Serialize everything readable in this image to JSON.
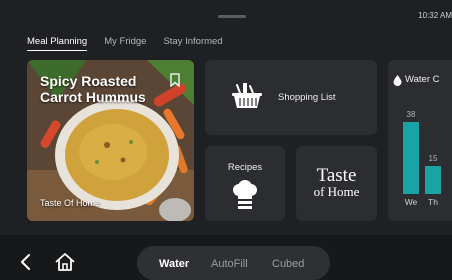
{
  "status": {
    "time": "10:32 AM"
  },
  "tabs": [
    {
      "label": "Meal Planning"
    },
    {
      "label": "My Fridge"
    },
    {
      "label": "Stay Informed"
    }
  ],
  "recipe_card": {
    "title_line1": "Spicy Roasted",
    "title_line2": "Carrot Hummus",
    "source": "Taste Of Home"
  },
  "shopping": {
    "label": "Shopping List"
  },
  "recipes": {
    "label": "Recipes"
  },
  "taste_logo": {
    "line1": "Taste",
    "line2": "of Home"
  },
  "water": {
    "label": "Water C",
    "bars": [
      {
        "day": "We",
        "value": 38
      },
      {
        "day": "Th",
        "value": 15
      }
    ],
    "accent": "#1aa3a5"
  },
  "dispenser": {
    "options": [
      "Water",
      "AutoFill",
      "Cubed"
    ],
    "selected": "Water"
  }
}
